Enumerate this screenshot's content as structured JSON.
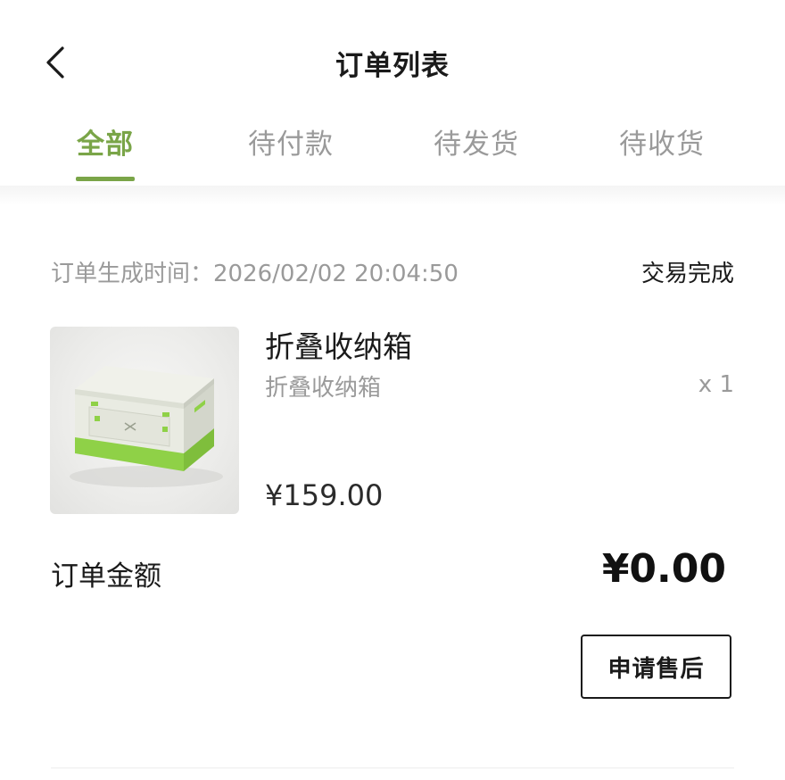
{
  "header": {
    "title": "订单列表",
    "back_icon": "chevron-left-icon"
  },
  "tabs": [
    {
      "label": "全部",
      "active": true
    },
    {
      "label": "待付款",
      "active": false
    },
    {
      "label": "待发货",
      "active": false
    },
    {
      "label": "待收货",
      "active": false
    }
  ],
  "theme": {
    "accent": "#7aa548",
    "muted_text": "#9a9a9a",
    "primary_text": "#1a1a1a"
  },
  "order": {
    "time_label": "订单生成时间：2026/02/02 20:04:50",
    "status": "交易完成",
    "product": {
      "name": "折叠收纳箱",
      "spec": "折叠收纳箱",
      "quantity": "x 1",
      "price": "¥159.00",
      "image_icon": "folding-storage-box-image"
    },
    "total_label": "订单金额",
    "total_amount": "¥0.00",
    "after_sale_label": "申请售后"
  }
}
